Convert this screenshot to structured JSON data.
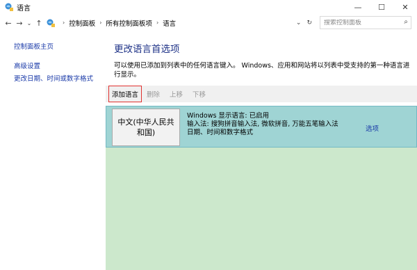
{
  "window": {
    "title": "语言",
    "minimize": "—",
    "maximize": "☐",
    "close": "✕"
  },
  "nav": {
    "back": "←",
    "forward": "→",
    "recent": "⌄",
    "up": "↑",
    "breadcrumb": [
      "控制面板",
      "所有控制面板项",
      "语言"
    ],
    "crumb_sep": "›",
    "dropdown": "⌄",
    "refresh": "↻"
  },
  "search": {
    "placeholder": "搜索控制面板",
    "icon": "⌕"
  },
  "sidebar": {
    "items": [
      "控制面板主页",
      "高级设置",
      "更改日期、时间或数字格式"
    ]
  },
  "main": {
    "title": "更改语言首选项",
    "description": "可以使用已添加到列表中的任何语言键入。 Windows、应用和网站将以列表中受支持的第一种语言进行显示。",
    "toolbar": {
      "add": "添加语言",
      "remove": "删除",
      "move_up": "上移",
      "move_down": "下移"
    },
    "languages": [
      {
        "name": "中文(中华人民共和国)",
        "display": "Windows 显示语言: 已启用",
        "input": "输入法: 搜狗拼音输入法, 微软拼音, 万能五笔输入法",
        "format": "日期、时间和数字格式",
        "options": "选项"
      }
    ]
  },
  "colors": {
    "link": "#1a3aa8",
    "heading": "#1e3287",
    "toolbar_bg": "#f0f0f0",
    "list_bg": "#cce8cc",
    "selected_row": "#9fd4d4",
    "highlight_box": "#e0302e"
  }
}
